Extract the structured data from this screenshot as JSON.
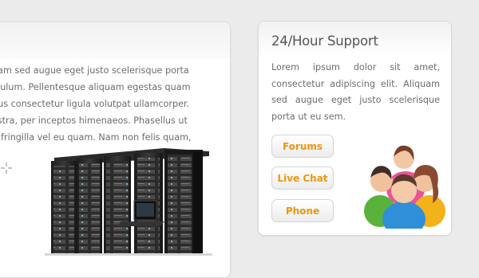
{
  "main": {
    "text": "uam sed augue eget justo scelerisque porta\nibulum. Pellentesque aliquam egestas quam\nbus consectetur ligula volutpat ullamcorper.\nostra, per inceptos himenaeos. Phasellus ut\nit fringilla vel eu quam. Nam non felis quam,"
  },
  "support": {
    "title": "24/Hour Support",
    "text": "Lorem ipsum dolor sit amet, consectetur adipiscing elit. Aliquam sed augue eget justo scelerisque porta ut eu sem.",
    "buttons": {
      "forums": "Forums",
      "live_chat": "Live Chat",
      "phone": "Phone"
    }
  },
  "icons": {
    "crosshair": "crosshair-icon",
    "servers": "server-rack-image",
    "people": "support-team-image"
  },
  "colors": {
    "accent": "#f0960a",
    "background": "#ebebeb"
  }
}
